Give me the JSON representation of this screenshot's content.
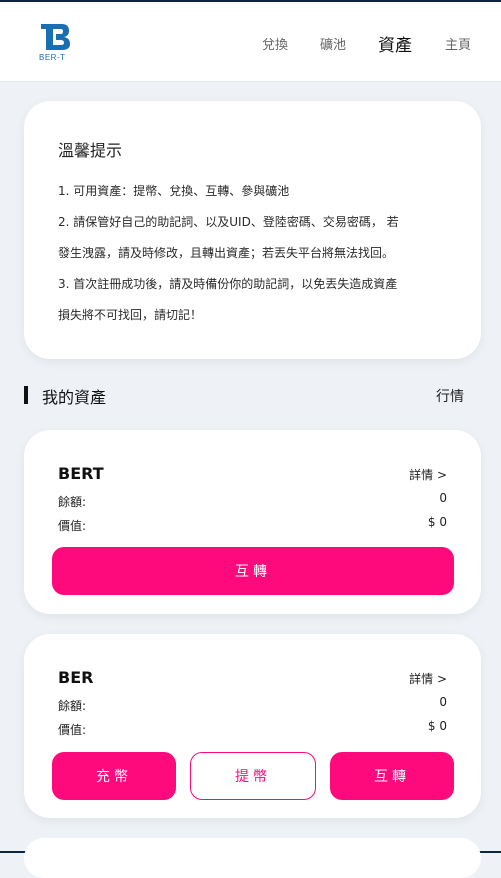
{
  "header": {
    "logo_text": "BER-T",
    "nav": [
      {
        "label": "兌換",
        "active": false
      },
      {
        "label": "礦池",
        "active": false
      },
      {
        "label": "資產",
        "active": true
      },
      {
        "label": "主頁",
        "active": false
      }
    ]
  },
  "notice": {
    "title": "溫馨提示",
    "lines": [
      "1. 可用資產：提幣、兌換、互轉、參與礦池",
      "2. 請保管好自己的助記詞、以及UID、登陸密碼、交易密碼， 若",
      "發生洩露，請及時修改，且轉出資產；若丟失平台將無法找回。",
      "3. 首次註冊成功後，請及時備份你的助記詞，以免丟失造成資產",
      "損失將不可找回，請切記！"
    ]
  },
  "section": {
    "title": "我的資產",
    "market_link": "行情"
  },
  "assets": [
    {
      "name": "BERT",
      "detail": "詳情 >",
      "balance_label": "餘額:",
      "balance": "0",
      "value_label": "價值:",
      "value": "$ 0",
      "buttons": [
        "互轉"
      ]
    },
    {
      "name": "BER",
      "detail": "詳情 >",
      "balance_label": "餘額:",
      "balance": "0",
      "value_label": "價值:",
      "value": "$ 0",
      "buttons": [
        "充幣",
        "提幣",
        "互轉"
      ]
    }
  ],
  "colors": {
    "accent": "#ff0a7c",
    "background": "#eef1f5",
    "logo_blue": "#1a6fb3"
  }
}
